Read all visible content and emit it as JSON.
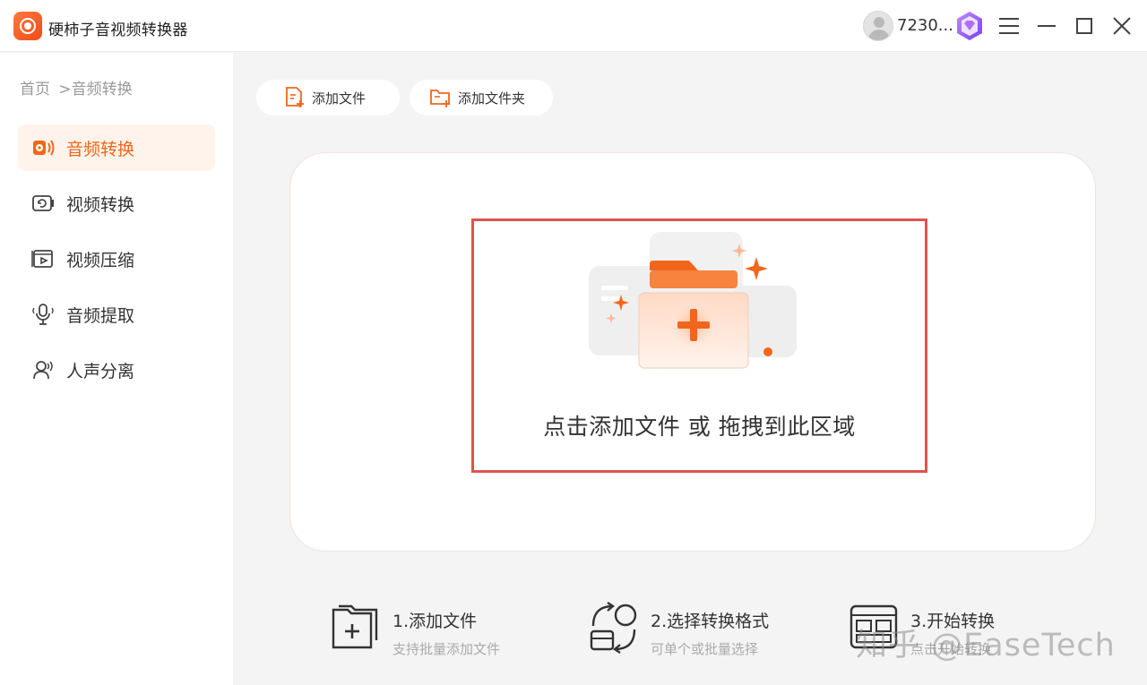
{
  "app": {
    "title": "硬柿子音视频转换器"
  },
  "header": {
    "username": "7230..."
  },
  "breadcrumb": {
    "home": "首页",
    "current": ">音频转换"
  },
  "sidebar": {
    "items": [
      {
        "label": "音频转换",
        "icon": "audio-convert-icon",
        "active": true
      },
      {
        "label": "视频转换",
        "icon": "video-convert-icon",
        "active": false
      },
      {
        "label": "视频压缩",
        "icon": "video-compress-icon",
        "active": false
      },
      {
        "label": "音频提取",
        "icon": "audio-extract-icon",
        "active": false
      },
      {
        "label": "人声分离",
        "icon": "vocal-separate-icon",
        "active": false
      }
    ]
  },
  "toolbar": {
    "add_file": "添加文件",
    "add_folder": "添加文件夹"
  },
  "dropzone": {
    "text": "点击添加文件 或 拖拽到此区域"
  },
  "steps": [
    {
      "title": "1.添加文件",
      "desc": "支持批量添加文件"
    },
    {
      "title": "2.选择转换格式",
      "desc": "可单个或批量选择"
    },
    {
      "title": "3.开始转换",
      "desc": "点击开始转换"
    }
  ],
  "watermark": {
    "text": "知乎 @EaseTech"
  },
  "colors": {
    "accent": "#f2661c",
    "highlight_border": "#e0534f"
  }
}
